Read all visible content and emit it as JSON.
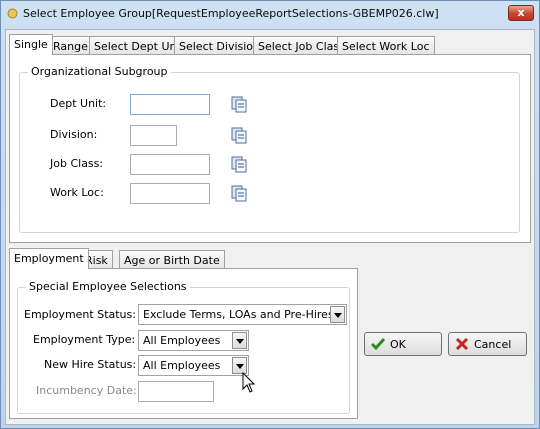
{
  "window": {
    "title": "Select Employee Group[RequestEmployeeReportSelections-GBEMP026.clw]",
    "close_label": "x"
  },
  "top_tabs": [
    "Single",
    "Range",
    "Select Dept Unit",
    "Select Division",
    "Select Job Class",
    "Select Work Loc"
  ],
  "subgroup": {
    "title": "Organizational Subgroup",
    "dept_unit_label": "Dept Unit:",
    "division_label": "Division:",
    "job_class_label": "Job Class:",
    "work_loc_label": "Work Loc:",
    "dept_unit_value": "",
    "division_value": "",
    "job_class_value": "",
    "work_loc_value": ""
  },
  "bottom_tabs": [
    "Employment",
    "Risk",
    "Age or Birth Date"
  ],
  "special": {
    "title": "Special Employee Selections",
    "employment_status_label": "Employment Status:",
    "employment_status_value": "Exclude Terms, LOAs and Pre-Hires",
    "employment_type_label": "Employment Type:",
    "employment_type_value": "All Employees",
    "new_hire_label": "New Hire Status:",
    "new_hire_value": "All Employees",
    "incumbency_label": "Incumbency Date:",
    "incumbency_value": ""
  },
  "buttons": {
    "ok": "OK",
    "cancel": "Cancel"
  },
  "colors": {
    "ok_check": "#2f8a1f",
    "cancel_x": "#c8201a",
    "close_button": "#c7442f"
  }
}
